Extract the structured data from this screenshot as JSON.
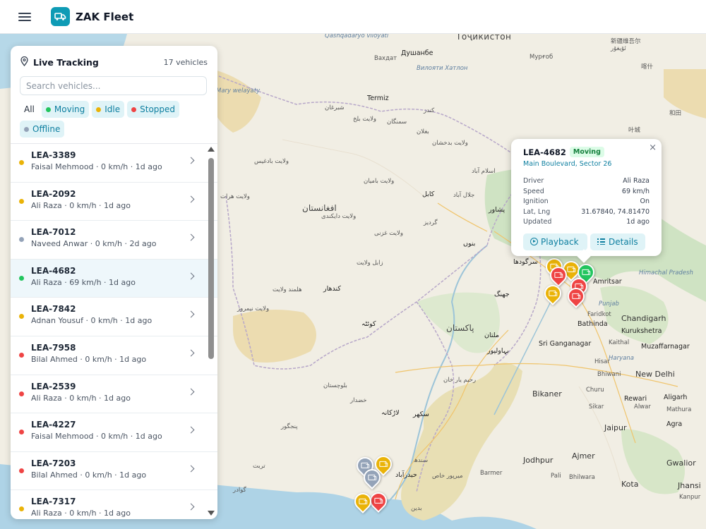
{
  "app": {
    "name": "ZAK Fleet"
  },
  "panel": {
    "title": "Live Tracking",
    "count_label": "17 vehicles",
    "search_placeholder": "Search vehicles...",
    "filters": [
      {
        "label": "All",
        "color": ""
      },
      {
        "label": "Moving",
        "color": "#22c55e"
      },
      {
        "label": "Idle",
        "color": "#eab308"
      },
      {
        "label": "Stopped",
        "color": "#ef4444"
      },
      {
        "label": "Offline",
        "color": "#94a3b8"
      }
    ],
    "vehicles": [
      {
        "plate": "LEA-3389",
        "meta": "Faisal Mehmood · 0 km/h · 1d ago",
        "status": "idle"
      },
      {
        "plate": "LEA-2092",
        "meta": "Ali Raza · 0 km/h · 1d ago",
        "status": "idle"
      },
      {
        "plate": "LEA-7012",
        "meta": "Naveed Anwar · 0 km/h · 2d ago",
        "status": "offline"
      },
      {
        "plate": "LEA-4682",
        "meta": "Ali Raza · 69 km/h · 1d ago",
        "status": "moving"
      },
      {
        "plate": "LEA-7842",
        "meta": "Adnan Yousuf · 0 km/h · 1d ago",
        "status": "idle"
      },
      {
        "plate": "LEA-7958",
        "meta": "Bilal Ahmed · 0 km/h · 1d ago",
        "status": "stopped"
      },
      {
        "plate": "LEA-2539",
        "meta": "Ali Raza · 0 km/h · 1d ago",
        "status": "stopped"
      },
      {
        "plate": "LEA-4227",
        "meta": "Faisal Mehmood · 0 km/h · 1d ago",
        "status": "stopped"
      },
      {
        "plate": "LEA-7203",
        "meta": "Bilal Ahmed · 0 km/h · 1d ago",
        "status": "stopped"
      },
      {
        "plate": "LEA-7317",
        "meta": "Ali Raza · 0 km/h · 1d ago",
        "status": "idle"
      }
    ],
    "selected_plate": "LEA-4682"
  },
  "status_colors": {
    "moving": "#22c55e",
    "idle": "#eab308",
    "stopped": "#ef4444",
    "offline": "#94a3b8"
  },
  "popup": {
    "plate": "LEA-4682",
    "badge": "Moving",
    "address": "Main Boulevard, Sector 26",
    "fields": [
      {
        "k": "Driver",
        "v": "Ali Raza"
      },
      {
        "k": "Speed",
        "v": "69 km/h"
      },
      {
        "k": "Ignition",
        "v": "On"
      },
      {
        "k": "Lat, Lng",
        "v": "31.67840, 74.81470"
      },
      {
        "k": "Updated",
        "v": "1d ago"
      }
    ],
    "playback_label": "Playback",
    "details_label": "Details",
    "close_glyph": "×"
  },
  "map_labels": {
    "tajikistan": "Тоҷикистон",
    "dushanbe": "Душанбе",
    "khatlon": "Вилояти Хатлон",
    "termiz": "Termiz",
    "mary": "Mary welaýaty",
    "qashqadaryo": "Qashqadaryo viloyati",
    "vahdat": "Вахдат",
    "murghob": "Мурғоб",
    "xinjiang_cn": "新疆维吾尔",
    "xinjiang_ug": "ئۇيغۇر",
    "hotan_cn": "和田",
    "kashgar_cn": "喀什",
    "yecheng_cn": "叶城",
    "himachal": "Himachal Pradesh",
    "afghanistan": "افغانستان",
    "sheberghan": "شبرغان",
    "mazar": "ولایت بلخ",
    "kunduz": "کندز",
    "samangan": "سمنگان",
    "baghlan": "بغلان",
    "badakhshan": "ولایت بدخشان",
    "bamyan": "ولایت بامیان",
    "herat": "ولایت هرات",
    "badghis": "ولایت بادغیس",
    "kabul": "کابل",
    "jalalabad": "جلال آباد",
    "peshawar": "پشاور",
    "gardez": "گردیز",
    "ghazni": "ولایت غزنی",
    "daykundi": "ولایت دایکندی",
    "zabul": "زابل ولایت",
    "helmand": "هلمند ولایت",
    "kandahar": "کندهار",
    "nimroz": "ولایت نیمروز",
    "quetta": "کوئٹہ",
    "pakistan": "پاکستان",
    "islamabad": "اسلام آباد",
    "bannu": "بنوں",
    "sargodha": "سرگودھا",
    "jhang": "جھنگ",
    "multan": "ملتان",
    "bahawalpur": "بہاولپور",
    "rahimyarkhan": "رحیم یار خان",
    "sukkur": "سکھر",
    "larkana": "لاڑکانہ",
    "hyderabad": "حیدرآباد",
    "balochistan": "بلوچستان",
    "khuzdar": "خضدار",
    "panjgur": "پنجگور",
    "gwadar": "گوادر",
    "turbat": "تربت",
    "sindh": "سندھ",
    "badin": "بدین",
    "mirpurkhas": "میرپور خاص",
    "amritsar": "Amritsar",
    "punjab": "Punjab",
    "faridkot": "Faridkot",
    "bathinda": "Bathinda",
    "chandigarh": "Chandigarh",
    "kurukshetra": "Kurukshetra",
    "muzaffarnagar": "Muzaffarnagar",
    "sriganganagar": "Sri Ganganagar",
    "kaithal": "Kaithal",
    "haryana": "Haryana",
    "hisar": "Hisar",
    "bhiwani": "Bhiwani",
    "newdelhi": "New Delhi",
    "bikaner": "Bikaner",
    "churu": "Churu",
    "rewari": "Rewari",
    "aligarh": "Aligarh",
    "sikar": "Sikar",
    "alwar": "Alwar",
    "jaipur": "Jaipur",
    "agra": "Agra",
    "jodhpur": "Jodhpur",
    "ajmer": "Ajmer",
    "barmer": "Barmer",
    "pali": "Pali",
    "bhilwara": "Bhilwara",
    "kota": "Kota",
    "gwalior": "Gwalior",
    "jhansi": "Jhansi",
    "mathura": "Mathura",
    "kanpur": "Kanpur"
  }
}
